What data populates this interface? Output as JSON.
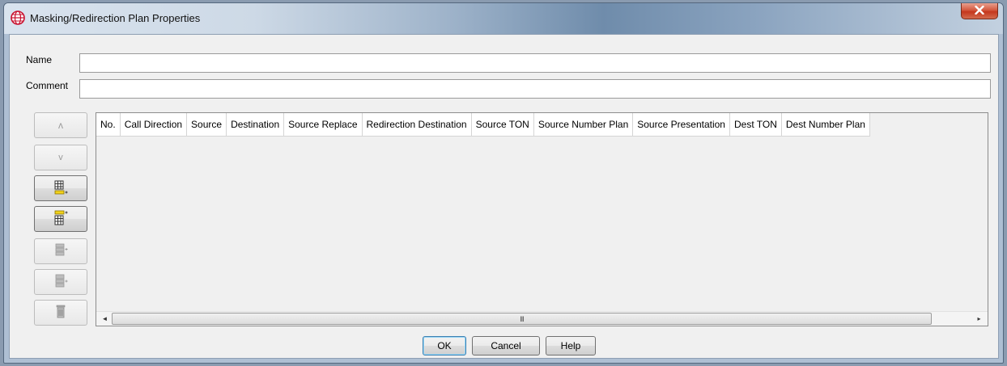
{
  "window": {
    "title": "Masking/Redirection Plan Properties",
    "icons": {
      "app": "globe-icon",
      "close": "close-icon"
    }
  },
  "form": {
    "name_label": "Name",
    "name_value": "",
    "comment_label": "Comment",
    "comment_value": ""
  },
  "side_toolbar": {
    "buttons": [
      {
        "icon": "move-up-icon",
        "glyph": "ʌ",
        "enabled": false
      },
      {
        "icon": "move-down-icon",
        "glyph": "v",
        "enabled": false
      },
      {
        "icon": "insert-row-below-icon",
        "enabled": true
      },
      {
        "icon": "insert-row-above-icon",
        "enabled": true
      },
      {
        "icon": "add-rule-icon",
        "enabled": false
      },
      {
        "icon": "add-rule-alt-icon",
        "enabled": false
      },
      {
        "icon": "delete-row-icon",
        "enabled": false
      }
    ]
  },
  "table": {
    "columns": [
      "No.",
      "Call Direction",
      "Source",
      "Destination",
      "Source Replace",
      "Redirection Destination",
      "Source TON",
      "Source Number Plan",
      "Source Presentation",
      "Dest TON",
      "Dest Number Plan"
    ],
    "rows": [],
    "scrollbar": {
      "left_glyph": "◄",
      "thumb_grip": "III",
      "right_glyph": "▸"
    }
  },
  "buttons": {
    "ok": "OK",
    "cancel": "Cancel",
    "help": "Help"
  },
  "colors": {
    "close_button": "#c4371d",
    "default_button_border": "#3c7fb1",
    "accent_title": "#6f8cab"
  }
}
